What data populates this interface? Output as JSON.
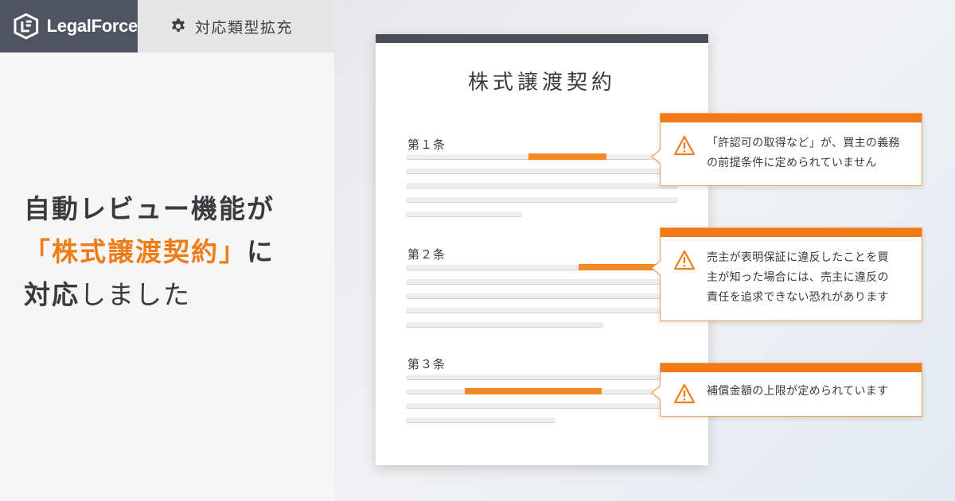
{
  "brand": {
    "name": "LegalForce",
    "color": "#505460"
  },
  "tag": {
    "icon": "gear-icon",
    "label": "対応類型拡充"
  },
  "headline": {
    "line1": "自動レビュー機能が",
    "line2_accent": "「株式譲渡契約」",
    "line2_suffix": "に",
    "line3_accent": "対応",
    "line3_suffix": "しました"
  },
  "document": {
    "title": "株式譲渡契約",
    "articles": [
      {
        "heading": "第１条"
      },
      {
        "heading": "第２条"
      },
      {
        "heading": "第３条"
      }
    ]
  },
  "callouts": [
    {
      "icon": "warning-icon",
      "lines": [
        "「許認可の取得など」が、買主の義務",
        "の前提条件に定められていません"
      ]
    },
    {
      "icon": "warning-icon",
      "lines": [
        "売主が表明保証に違反したことを買",
        "主が知った場合には、売主に違反の",
        "責任を追求できない恐れがあります"
      ]
    },
    {
      "icon": "warning-icon",
      "lines": [
        "補償金額の上限が定められています"
      ]
    }
  ],
  "colors": {
    "accent": "#ef7d17",
    "text": "#3a3a3f",
    "doc_bar": "#4a4c57"
  }
}
